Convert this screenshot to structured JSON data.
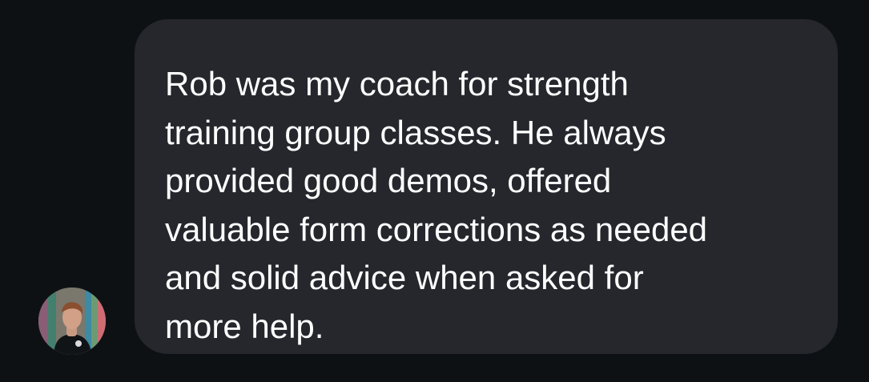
{
  "conversation": {
    "message": {
      "lines": [
        "Rob was my coach for strength",
        "training group classes. He always",
        "provided good demos, offered",
        "valuable form corrections as needed",
        "and solid advice when asked for",
        "more help."
      ]
    },
    "sender": {
      "avatar_icon": "profile-photo"
    }
  },
  "colors": {
    "background": "#0e1114",
    "bubble": "#25272d",
    "text": "#ffffff"
  }
}
